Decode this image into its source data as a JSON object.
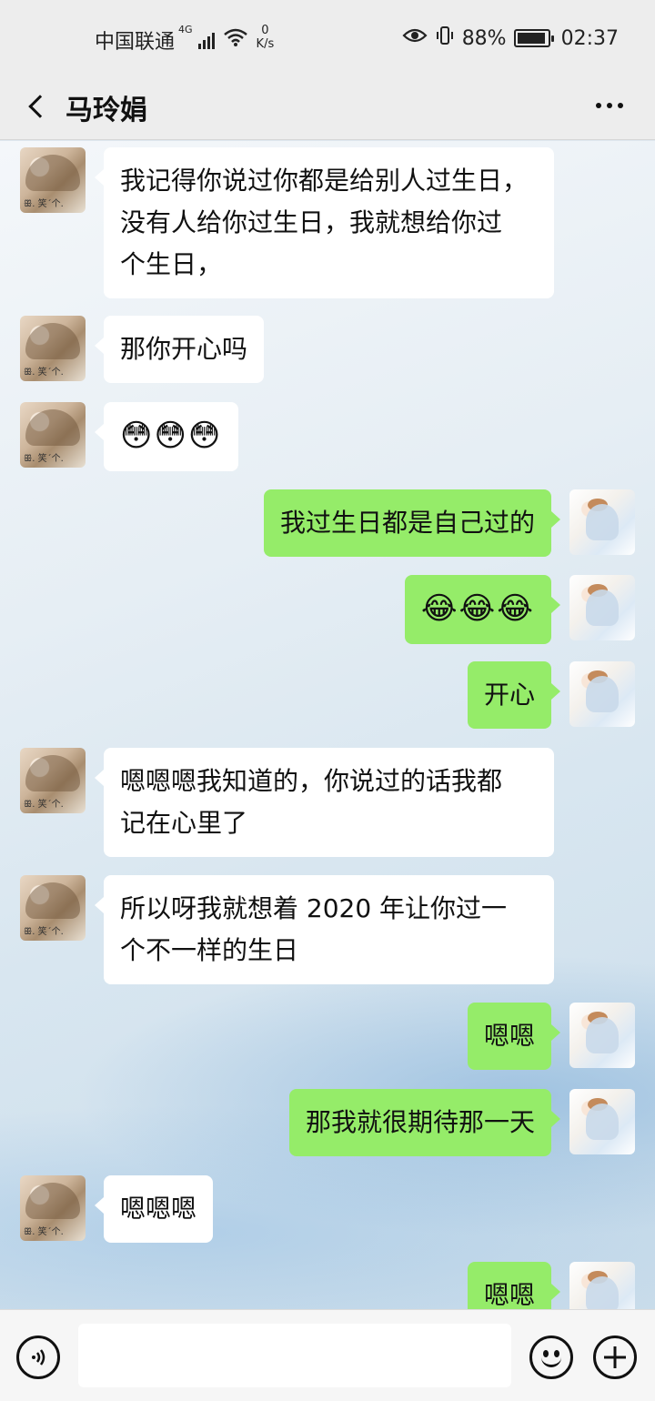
{
  "status_bar": {
    "carrier": "中国联通",
    "network": "4G",
    "net_speed_value": "0",
    "net_speed_unit": "K/s",
    "battery": "88%",
    "time": "02:37"
  },
  "header": {
    "title": "马玲娟"
  },
  "messages": [
    {
      "side": "left",
      "text": "我记得你说过你都是给别人过生日，\n没有人给你过生日，我就想给你过\n个生日，"
    },
    {
      "side": "left",
      "text": "那你开心吗"
    },
    {
      "side": "left",
      "text": "😳😳😳"
    },
    {
      "side": "right",
      "text": "我过生日都是自己过的"
    },
    {
      "side": "right",
      "text": "😂😂😂"
    },
    {
      "side": "right",
      "text": "开心"
    },
    {
      "side": "left",
      "text": "嗯嗯嗯我知道的，你说过的话我都\n记在心里了"
    },
    {
      "side": "left",
      "text": "所以呀我就想着 2020 年让你过一\n个不一样的生日"
    },
    {
      "side": "right",
      "text": "嗯嗯"
    },
    {
      "side": "right",
      "text": "那我就很期待那一天"
    },
    {
      "side": "left",
      "text": "嗯嗯嗯"
    },
    {
      "side": "right",
      "text": "嗯嗯"
    }
  ],
  "colors": {
    "own_bubble": "#95ec69",
    "other_bubble": "#ffffff",
    "header_bg": "#ededed"
  },
  "icons": {
    "back": "back-arrow-icon",
    "more": "more-dots-icon",
    "voice": "voice-icon",
    "emoji": "emoji-icon",
    "add": "add-icon"
  }
}
